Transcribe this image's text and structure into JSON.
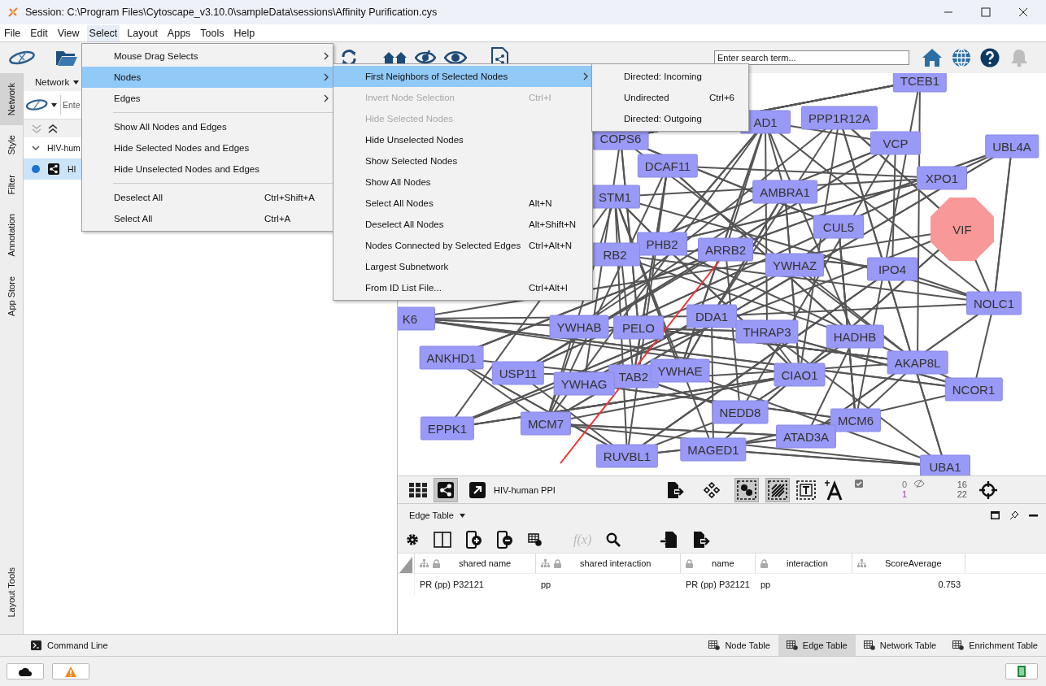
{
  "window": {
    "title": "Session: C:\\Program Files\\Cytoscape_v3.10.0\\sampleData\\sessions\\Affinity Purification.cys"
  },
  "menubar": [
    {
      "label": "File",
      "selected": false
    },
    {
      "label": "Edit",
      "selected": false
    },
    {
      "label": "View",
      "selected": false
    },
    {
      "label": "Select",
      "selected": true
    },
    {
      "label": "Layout",
      "selected": false
    },
    {
      "label": "Apps",
      "selected": false
    },
    {
      "label": "Tools",
      "selected": false
    },
    {
      "label": "Help",
      "selected": false
    }
  ],
  "search": {
    "placeholder": "Enter search term..."
  },
  "side_tabs": [
    {
      "label": "Network",
      "selected": true
    },
    {
      "label": "Style",
      "selected": false
    },
    {
      "label": "Filter",
      "selected": false
    },
    {
      "label": "Annotation",
      "selected": false
    },
    {
      "label": "App Store",
      "selected": false
    },
    {
      "label": "Layout Tools",
      "selected": false
    }
  ],
  "network_panel": {
    "header": "Network",
    "search_placeholder": "Ente",
    "tree": [
      {
        "label": "HIV-hum",
        "expanded": true,
        "selected": false,
        "children": [
          {
            "label": "HI",
            "selected": true
          }
        ]
      }
    ]
  },
  "canvas": {
    "nodes": [
      {
        "label": "TCEB1",
        "kind": "rect"
      },
      {
        "label": "AD1",
        "kind": "rect"
      },
      {
        "label": "PPP1R12A",
        "kind": "rect"
      },
      {
        "label": "VCP",
        "kind": "rect"
      },
      {
        "label": "UBL4A",
        "kind": "rect"
      },
      {
        "label": "COPS6",
        "kind": "rect"
      },
      {
        "label": "DCAF11",
        "kind": "rect"
      },
      {
        "label": "XPO1",
        "kind": "rect"
      },
      {
        "label": "AMBRA1",
        "kind": "rect"
      },
      {
        "label": "STM1",
        "kind": "rect"
      },
      {
        "label": "CUL5",
        "kind": "rect"
      },
      {
        "label": "VIF",
        "kind": "octagon"
      },
      {
        "label": "PHB2",
        "kind": "rect"
      },
      {
        "label": "ARRB2",
        "kind": "rect"
      },
      {
        "label": "RB2",
        "kind": "rect"
      },
      {
        "label": "YWHAZ",
        "kind": "rect"
      },
      {
        "label": "IPO4",
        "kind": "rect"
      },
      {
        "label": "NOLC1",
        "kind": "rect"
      },
      {
        "label": "K6",
        "kind": "rect"
      },
      {
        "label": "YWHAB",
        "kind": "rect"
      },
      {
        "label": "PELO",
        "kind": "rect"
      },
      {
        "label": "DDA1",
        "kind": "rect"
      },
      {
        "label": "THRAP3",
        "kind": "rect"
      },
      {
        "label": "HADHB",
        "kind": "rect"
      },
      {
        "label": "ANKHD1",
        "kind": "rect"
      },
      {
        "label": "AKAP8L",
        "kind": "rect"
      },
      {
        "label": "USP11",
        "kind": "rect"
      },
      {
        "label": "TAB2",
        "kind": "rect"
      },
      {
        "label": "YWHAE",
        "kind": "rect"
      },
      {
        "label": "CIAO1",
        "kind": "rect"
      },
      {
        "label": "YWHAG",
        "kind": "rect"
      },
      {
        "label": "NCOR1",
        "kind": "rect"
      },
      {
        "label": "EPPK1",
        "kind": "rect"
      },
      {
        "label": "MCM7",
        "kind": "rect"
      },
      {
        "label": "NEDD8",
        "kind": "rect"
      },
      {
        "label": "MCM6",
        "kind": "rect"
      },
      {
        "label": "ATAD3A",
        "kind": "rect"
      },
      {
        "label": "RUVBL1",
        "kind": "rect"
      },
      {
        "label": "MAGED1",
        "kind": "rect"
      },
      {
        "label": "UBA1",
        "kind": "rect"
      }
    ]
  },
  "view_toolbar": {
    "network_name": "HIV-human PPI",
    "selection_counts": [
      "0",
      "1"
    ],
    "hidden_counts": [
      "16",
      "22"
    ]
  },
  "table_panel": {
    "title": "Edge Table",
    "function_button": "f(x)",
    "columns": [
      {
        "label": "shared name",
        "shared": true,
        "locked": true
      },
      {
        "label": "shared interaction",
        "shared": true,
        "locked": true
      },
      {
        "label": "name",
        "shared": false,
        "locked": true
      },
      {
        "label": "interaction",
        "shared": false,
        "locked": true
      },
      {
        "label": "ScoreAverage",
        "shared": true,
        "locked": false
      }
    ],
    "rows": [
      [
        "PR (pp) P32121",
        "pp",
        "PR (pp) P32121",
        "pp",
        "0.753"
      ]
    ]
  },
  "bottom_bar": {
    "command_line": "Command Line",
    "tabs": [
      {
        "label": "Node Table",
        "selected": false
      },
      {
        "label": "Edge Table",
        "selected": true
      },
      {
        "label": "Network Table",
        "selected": false
      },
      {
        "label": "Enrichment Table",
        "selected": false
      }
    ]
  },
  "select_menu": {
    "items": [
      {
        "kind": "item",
        "label": "Mouse Drag Selects",
        "submenu": true,
        "selected": false,
        "disabled": false
      },
      {
        "kind": "item",
        "label": "Nodes",
        "submenu": true,
        "selected": true,
        "disabled": false
      },
      {
        "kind": "item",
        "label": "Edges",
        "submenu": true,
        "selected": false,
        "disabled": false
      },
      {
        "kind": "separator"
      },
      {
        "kind": "item",
        "label": "Show All Nodes and Edges",
        "submenu": false,
        "selected": false,
        "disabled": false
      },
      {
        "kind": "item",
        "label": "Hide Selected Nodes and Edges",
        "submenu": false,
        "selected": false,
        "disabled": false
      },
      {
        "kind": "item",
        "label": "Hide Unselected Nodes and Edges",
        "submenu": false,
        "selected": false,
        "disabled": false
      },
      {
        "kind": "separator"
      },
      {
        "kind": "item",
        "label": "Deselect All",
        "shortcut": "Ctrl+Shift+A",
        "submenu": false,
        "selected": false,
        "disabled": false
      },
      {
        "kind": "item",
        "label": "Select All",
        "shortcut": "Ctrl+A",
        "submenu": false,
        "selected": false,
        "disabled": false
      }
    ]
  },
  "nodes_submenu": {
    "items": [
      {
        "kind": "item",
        "label": "First Neighbors of Selected Nodes",
        "submenu": true,
        "selected": true,
        "disabled": false
      },
      {
        "kind": "item",
        "label": "Invert Node Selection",
        "shortcut": "Ctrl+I",
        "submenu": false,
        "selected": false,
        "disabled": true
      },
      {
        "kind": "item",
        "label": "Hide Selected Nodes",
        "submenu": false,
        "selected": false,
        "disabled": true
      },
      {
        "kind": "item",
        "label": "Hide Unselected Nodes",
        "submenu": false,
        "selected": false,
        "disabled": false
      },
      {
        "kind": "item",
        "label": "Show Selected Nodes",
        "submenu": false,
        "selected": false,
        "disabled": false
      },
      {
        "kind": "item",
        "label": "Show All Nodes",
        "submenu": false,
        "selected": false,
        "disabled": false
      },
      {
        "kind": "item",
        "label": "Select All Nodes",
        "shortcut": "Alt+N",
        "submenu": false,
        "selected": false,
        "disabled": false
      },
      {
        "kind": "item",
        "label": "Deselect All Nodes",
        "shortcut": "Alt+Shift+N",
        "submenu": false,
        "selected": false,
        "disabled": false
      },
      {
        "kind": "item",
        "label": "Nodes Connected by Selected Edges",
        "shortcut": "Ctrl+Alt+N",
        "submenu": false,
        "selected": false,
        "disabled": false
      },
      {
        "kind": "item",
        "label": "Largest Subnetwork",
        "submenu": false,
        "selected": false,
        "disabled": false
      },
      {
        "kind": "item",
        "label": "From ID List File...",
        "shortcut": "Ctrl+Alt+I",
        "submenu": false,
        "selected": false,
        "disabled": false
      }
    ]
  },
  "neighbors_submenu": {
    "items": [
      {
        "kind": "item",
        "label": "Directed: Incoming",
        "submenu": false,
        "selected": false,
        "disabled": false
      },
      {
        "kind": "item",
        "label": "Undirected",
        "shortcut": "Ctrl+6",
        "submenu": false,
        "selected": false,
        "disabled": false
      },
      {
        "kind": "item",
        "label": "Directed: Outgoing",
        "submenu": false,
        "selected": false,
        "disabled": false
      }
    ]
  }
}
